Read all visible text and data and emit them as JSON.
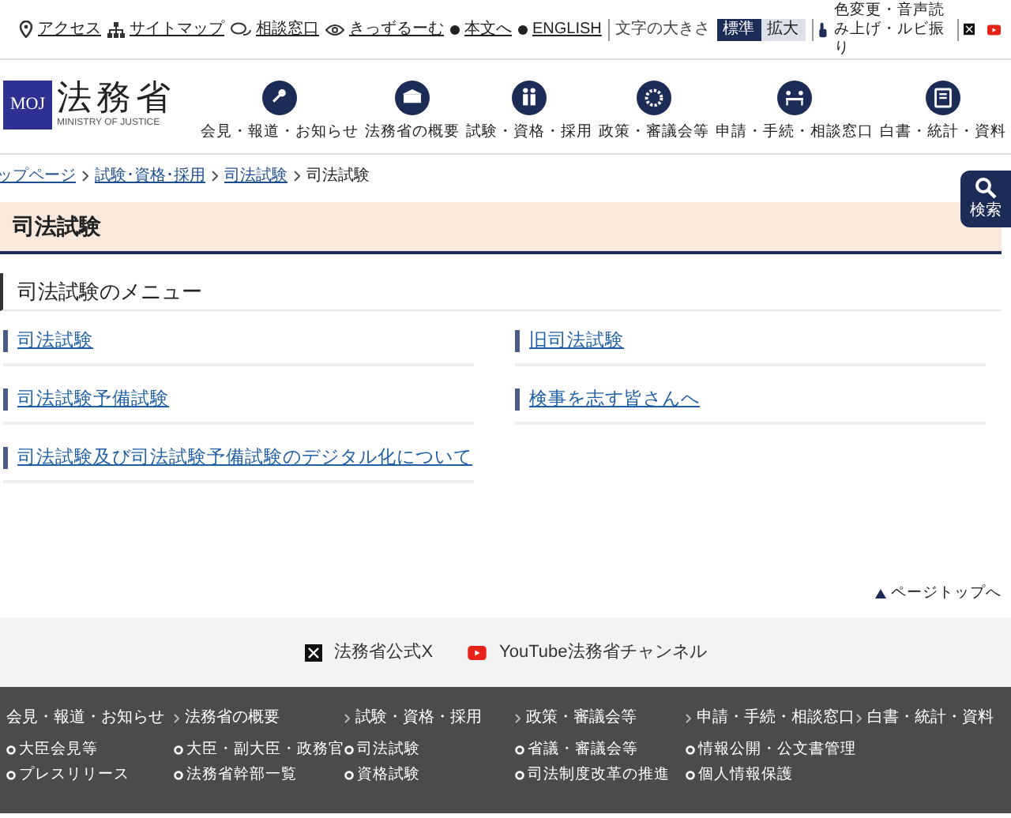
{
  "utility_bar": {
    "links": [
      {
        "kind": "pin",
        "label": "アクセス"
      },
      {
        "kind": "sitemap",
        "label": "サイトマップ"
      },
      {
        "kind": "chat",
        "label": "相談窓口"
      },
      {
        "kind": "eye",
        "label": "きっずるーむ"
      },
      {
        "kind": "dot",
        "label": "本文へ"
      },
      {
        "kind": "dot",
        "label": "ENGLISH"
      }
    ],
    "font_size_label": "文字の大きさ",
    "font_sizes": [
      {
        "label": "標準",
        "selected": true
      },
      {
        "label": "拡大",
        "selected": false
      }
    ],
    "accessibility": "色変更・音声読み上げ・ルビ振り"
  },
  "logo": {
    "mark": "MOJ",
    "name": "法務省",
    "subtitle": "MINISTRY OF JUSTICE"
  },
  "nav": [
    {
      "kind": "mic",
      "label": "会見・報道・お知らせ"
    },
    {
      "kind": "building",
      "label": "法務省の概要"
    },
    {
      "kind": "people",
      "label": "試験・資格・採用"
    },
    {
      "kind": "ring",
      "label": "政策・審議会等"
    },
    {
      "kind": "desk",
      "label": "申請・手続・相談窓口"
    },
    {
      "kind": "doc",
      "label": "白書・統計・資料"
    }
  ],
  "search_button": {
    "label": "検索"
  },
  "breadcrumb": [
    {
      "label": "ップページ",
      "link": true
    },
    {
      "label": "試験･資格･採用",
      "link": true
    },
    {
      "label": "司法試験",
      "link": true
    },
    {
      "label": "司法試験",
      "link": false
    }
  ],
  "page_title": "司法試験",
  "menu_heading": "司法試験のメニュー",
  "menu_links": [
    "司法試験",
    "旧司法試験",
    "司法試験予備試験",
    "検事を志す皆さんへ",
    "司法試験及び司法試験予備試験のデジタル化について"
  ],
  "page_top": "ページトップへ",
  "social": [
    {
      "kind": "x",
      "label": "法務省公式X"
    },
    {
      "kind": "youtube",
      "label": "YouTube法務省チャンネル"
    }
  ],
  "footer": [
    {
      "title": "会見・報道・お知らせ",
      "items": [
        "大臣会見等",
        "プレスリリース"
      ]
    },
    {
      "title": "法務省の概要",
      "items": [
        "大臣・副大臣・政務官",
        "法務省幹部一覧"
      ]
    },
    {
      "title": "試験・資格・採用",
      "items": [
        "司法試験",
        "資格試験"
      ]
    },
    {
      "title": "政策・審議会等",
      "items": [
        "省議・審議会等",
        "司法制度改革の推進"
      ]
    },
    {
      "title": "申請・手続・相談窓口",
      "items": [
        "情報公開・公文書管理",
        "個人情報保護"
      ]
    },
    {
      "title": "白書・統計・資料"
    }
  ]
}
